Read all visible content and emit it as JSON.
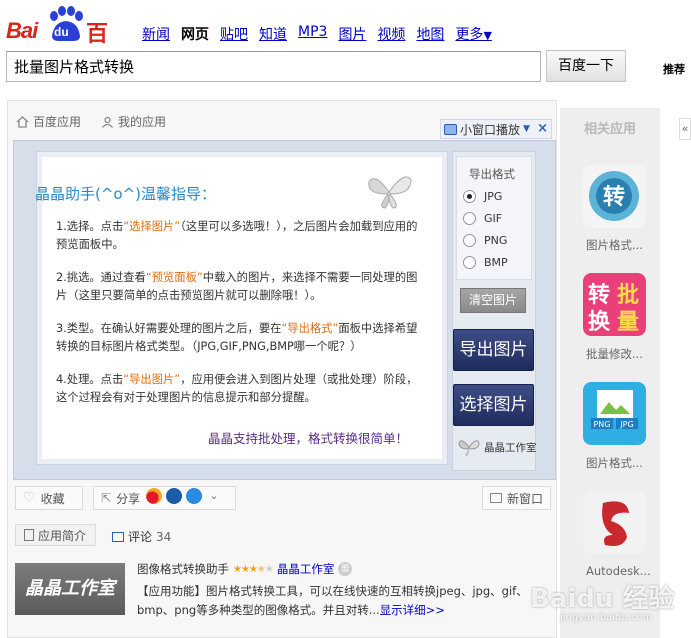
{
  "logo": {
    "bai": "Bai",
    "du": "du",
    "cn": "百度"
  },
  "nav": [
    {
      "label": "新闻",
      "active": false
    },
    {
      "label": "网页",
      "active": true
    },
    {
      "label": "贴吧",
      "active": false
    },
    {
      "label": "知道",
      "active": false
    },
    {
      "label": "MP3",
      "active": false
    },
    {
      "label": "图片",
      "active": false
    },
    {
      "label": "视频",
      "active": false
    },
    {
      "label": "地图",
      "active": false
    },
    {
      "label": "更多",
      "active": false
    }
  ],
  "search": {
    "value": "批量图片格式转换",
    "button": "百度一下",
    "right_label": "推荐"
  },
  "breadcrumb": {
    "home": "百度应用",
    "mine": "我的应用"
  },
  "miniwin": {
    "label": "小窗口播放"
  },
  "guide": {
    "title": "晶晶助手(^o^)温馨指导：",
    "steps": [
      {
        "pre": "1.选择。点击",
        "hl": "“选择图片”",
        "post": "（这里可以多选哦！），之后图片会加载到应用的预览面板中。"
      },
      {
        "pre": "2.挑选。通过查看",
        "hl": "“预览面板”",
        "post": "中载入的图片，来选择不需要一同处理的图片（这里只要简单的点击预览图片就可以删除哦！）。"
      },
      {
        "pre": "3.类型。在确认好需要处理的图片之后，要在",
        "hl": "“导出格式”",
        "post": "面板中选择希望转换的目标图片格式类型。（JPG,GIF,PNG,BMP哪一个呢？）"
      },
      {
        "pre": "4.处理。点击",
        "hl": "“导出图片”",
        "post": "，应用便会进入到图片处理（或批处理）阶段，这个过程会有对于处理图片的信息提示和部分提醒。"
      }
    ],
    "footer": "晶晶支持批处理，格式转换很简单！"
  },
  "export": {
    "title": "导出格式",
    "options": [
      {
        "label": "JPG",
        "selected": true
      },
      {
        "label": "GIF",
        "selected": false
      },
      {
        "label": "PNG",
        "selected": false
      },
      {
        "label": "BMP",
        "selected": false
      }
    ],
    "clear": "清空图片",
    "export_btn": "导出图片",
    "select_btn": "选择图片",
    "studio": "晶晶工作室"
  },
  "actions": {
    "fav": "收藏",
    "share": "分享",
    "newwin": "新窗口"
  },
  "tabs": {
    "intro": "应用简介",
    "comment": "评论",
    "comment_count": "34"
  },
  "app": {
    "thumb_text": "晶晶工作室",
    "name": "图像格式转换助手",
    "rating": 3.5,
    "developer": "晶晶工作室",
    "badge": "盟",
    "description": "【应用功能】图片格式转换工具，可以在线快速的互相转换jpeg、jpg、gif、bmp、png等多种类型的图像格式。并且对转...",
    "more": "显示详细>>"
  },
  "related": {
    "title": "相关应用",
    "collapse": "«",
    "items": [
      {
        "label": "图片格式...",
        "icon": "convert-icon"
      },
      {
        "label": "批量修改...",
        "icon": "batch-convert-icon"
      },
      {
        "label": "图片格式...",
        "icon": "png-jpg-icon"
      },
      {
        "label": "Autodesk...",
        "icon": "autodesk-icon"
      }
    ]
  },
  "watermark": {
    "text": "Baidu 经验",
    "sub": "jingyan.baidu.com"
  },
  "colors": {
    "brand_red": "#d9261c",
    "link_blue": "#0000cc",
    "guide_blue": "#2a8ac8",
    "button_navy": "#1e2b5c"
  }
}
